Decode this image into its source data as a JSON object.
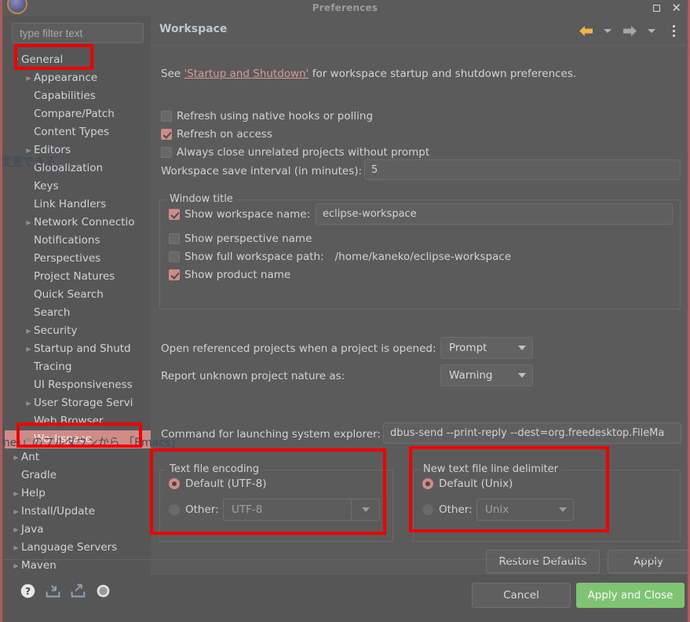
{
  "window": {
    "title": "Preferences",
    "buttons": {
      "maximize": "maximize-icon",
      "close": "close-icon"
    }
  },
  "sidebar": {
    "filter_placeholder": "type filter text",
    "items": [
      {
        "label": "General",
        "indent": 0,
        "arrow": "open",
        "selected": false
      },
      {
        "label": "Appearance",
        "indent": 1,
        "arrow": "closed",
        "selected": false
      },
      {
        "label": "Capabilities",
        "indent": 1,
        "arrow": "none",
        "selected": false
      },
      {
        "label": "Compare/Patch",
        "indent": 1,
        "arrow": "none",
        "selected": false
      },
      {
        "label": "Content Types",
        "indent": 1,
        "arrow": "none",
        "selected": false
      },
      {
        "label": "Editors",
        "indent": 1,
        "arrow": "closed",
        "selected": false
      },
      {
        "label": "Globalization",
        "indent": 1,
        "arrow": "none",
        "selected": false
      },
      {
        "label": "Keys",
        "indent": 1,
        "arrow": "none",
        "selected": false
      },
      {
        "label": "Link Handlers",
        "indent": 1,
        "arrow": "none",
        "selected": false
      },
      {
        "label": "Network Connectio",
        "indent": 1,
        "arrow": "closed",
        "selected": false
      },
      {
        "label": "Notifications",
        "indent": 1,
        "arrow": "none",
        "selected": false
      },
      {
        "label": "Perspectives",
        "indent": 1,
        "arrow": "none",
        "selected": false
      },
      {
        "label": "Project Natures",
        "indent": 1,
        "arrow": "none",
        "selected": false
      },
      {
        "label": "Quick Search",
        "indent": 1,
        "arrow": "none",
        "selected": false
      },
      {
        "label": "Search",
        "indent": 1,
        "arrow": "none",
        "selected": false
      },
      {
        "label": "Security",
        "indent": 1,
        "arrow": "closed",
        "selected": false
      },
      {
        "label": "Startup and Shutd",
        "indent": 1,
        "arrow": "closed",
        "selected": false
      },
      {
        "label": "Tracing",
        "indent": 1,
        "arrow": "none",
        "selected": false
      },
      {
        "label": "UI Responsiveness",
        "indent": 1,
        "arrow": "none",
        "selected": false
      },
      {
        "label": "User Storage Servi",
        "indent": 1,
        "arrow": "closed",
        "selected": false
      },
      {
        "label": "Web Browser",
        "indent": 1,
        "arrow": "none",
        "selected": false
      },
      {
        "label": "Workspace",
        "indent": 1,
        "arrow": "closed",
        "selected": true
      },
      {
        "label": "Ant",
        "indent": 0,
        "arrow": "closed",
        "selected": false
      },
      {
        "label": "Gradle",
        "indent": 0,
        "arrow": "none",
        "selected": false
      },
      {
        "label": "Help",
        "indent": 0,
        "arrow": "closed",
        "selected": false
      },
      {
        "label": "Install/Update",
        "indent": 0,
        "arrow": "closed",
        "selected": false
      },
      {
        "label": "Java",
        "indent": 0,
        "arrow": "closed",
        "selected": false
      },
      {
        "label": "Language Servers",
        "indent": 0,
        "arrow": "closed",
        "selected": false
      },
      {
        "label": "Maven",
        "indent": 0,
        "arrow": "closed",
        "selected": false
      }
    ],
    "bottom_icons": [
      "help-icon",
      "import-icon",
      "export-icon",
      "circle-icon"
    ]
  },
  "page": {
    "title": "Workspace",
    "nav": {
      "back": "back-arrow-icon",
      "back_menu": "chevron-down-icon",
      "forward": "forward-arrow-icon",
      "forward_menu": "chevron-down-icon",
      "menu": "kebab-menu-icon"
    },
    "description": {
      "prefix": "See ",
      "link": "'Startup and Shutdown'",
      "suffix": " for workspace startup and shutdown preferences."
    },
    "checkboxes": [
      {
        "label": "Refresh using native hooks or polling",
        "checked": false,
        "mnemonic": "R"
      },
      {
        "label": "Refresh on access",
        "checked": true,
        "mnemonic": "s"
      },
      {
        "label": "Always close unrelated projects without prompt",
        "checked": false,
        "mnemonic": "c"
      }
    ],
    "save_interval": {
      "label": "Workspace save interval (in minutes):",
      "value": "5"
    },
    "window_title_group": {
      "title": "Window title",
      "show_workspace_name": {
        "label": "Show workspace name:",
        "checked": true,
        "value": "eclipse-workspace"
      },
      "show_perspective_name": {
        "label": "Show perspective name",
        "checked": false
      },
      "show_full_workspace_path": {
        "label": "Show full workspace path:",
        "checked": false,
        "value": "/home/kaneko/eclipse-workspace"
      },
      "show_product_name": {
        "label": "Show product name",
        "checked": true
      }
    },
    "open_referenced": {
      "label": "Open referenced projects when a project is opened:",
      "value": "Prompt"
    },
    "report_nature": {
      "label": "Report unknown project nature as:",
      "value": "Warning"
    },
    "system_explorer": {
      "label": "Command for launching system explorer:",
      "value": "dbus-send --print-reply --dest=org.freedesktop.FileMa"
    },
    "text_file_encoding": {
      "title": "Text file encoding",
      "default_label": "Default (UTF-8)",
      "default_selected": true,
      "other_label": "Other:",
      "other_selected": false,
      "other_value": "UTF-8"
    },
    "line_delimiter": {
      "title": "New text file line delimiter",
      "default_label": "Default (Unix)",
      "default_selected": true,
      "other_label": "Other:",
      "other_selected": false,
      "other_value": "Unix"
    },
    "restore_defaults": "Restore Defaults",
    "apply": "Apply"
  },
  "footer": {
    "cancel": "Cancel",
    "apply_and_close": "Apply and Close"
  },
  "overlay_text": {
    "note_left": "変更できる",
    "note_bottom": "me)」のプルダウンから 「Emacs」"
  },
  "colors": {
    "accent_selection": "#cf8b86",
    "green_button": "#7ec473",
    "annotation_red": "#f10000",
    "panel_bg": "#5b5b5b",
    "sidebar_bg": "#565656"
  }
}
